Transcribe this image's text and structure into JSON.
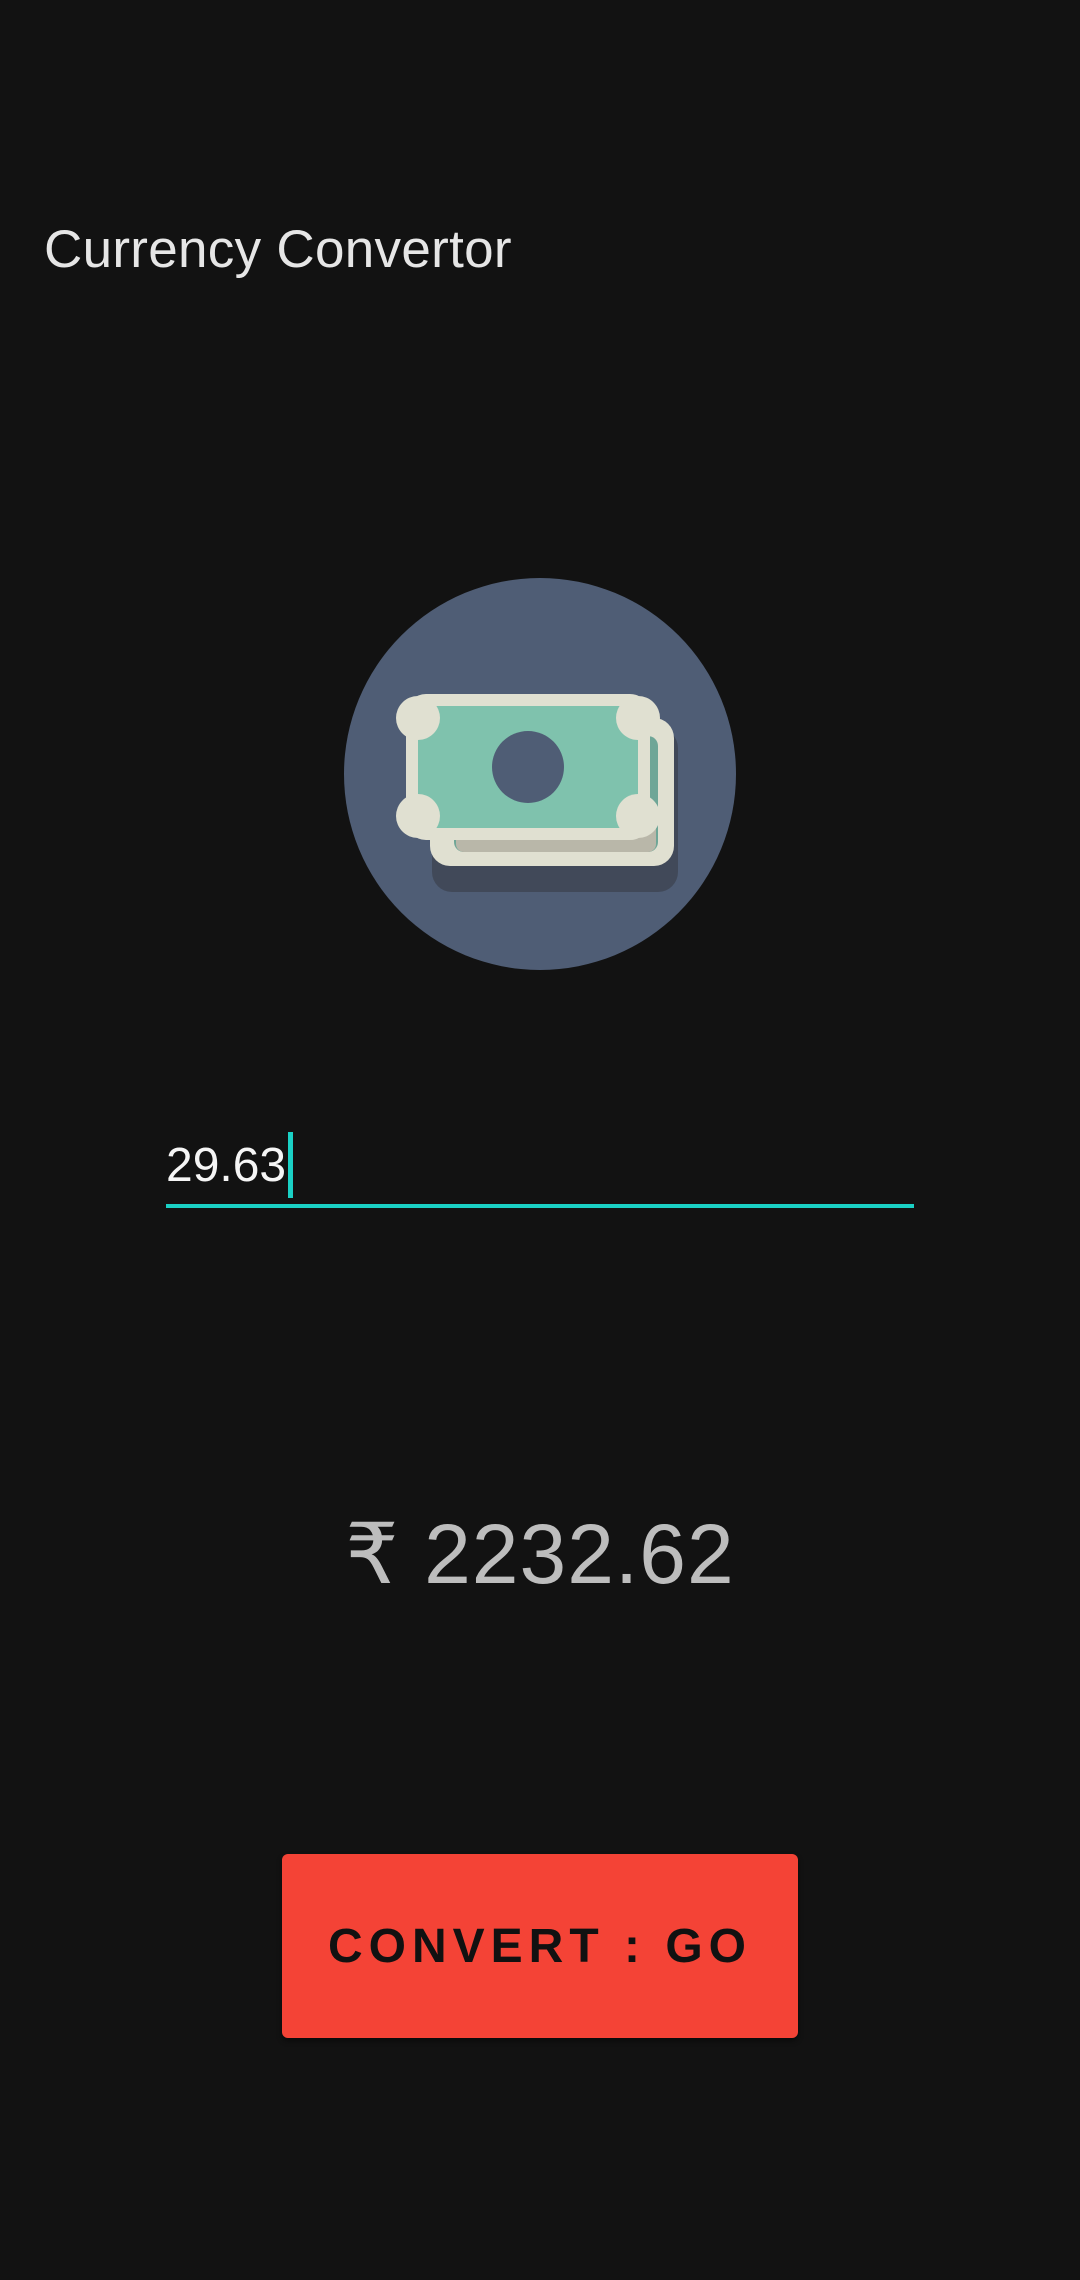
{
  "app": {
    "title": "Currency Convertor"
  },
  "illustration": {
    "icon": "banknotes-icon",
    "circle_color": "#4f5d75",
    "note_color": "#7fc2ad",
    "note_border_color": "#e0e0d1"
  },
  "amount_input": {
    "value": "29.63",
    "accent_color": "#1ad1c5"
  },
  "result": {
    "text": "₹ 2232.62"
  },
  "convert_button": {
    "label": "CONVERT : GO",
    "color": "#f44336"
  }
}
